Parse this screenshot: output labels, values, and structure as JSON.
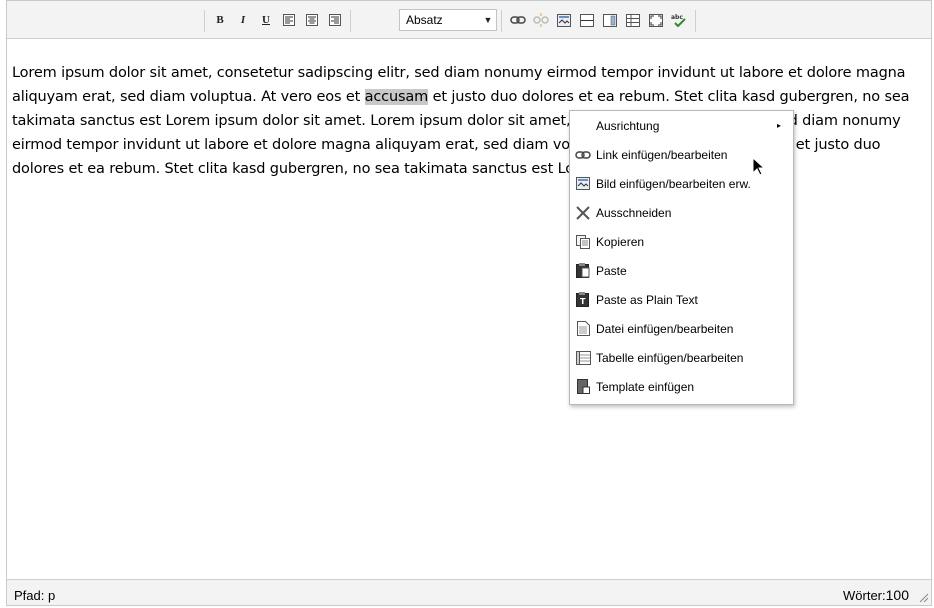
{
  "toolbar": {
    "format_select": {
      "value": "Absatz"
    },
    "buttons": [
      "bold",
      "italic",
      "underline",
      "align-left",
      "align-center",
      "align-right",
      "link",
      "unlink",
      "image",
      "horizontal-rule",
      "template",
      "table",
      "fullscreen",
      "spellcheck"
    ],
    "bold_label": "B",
    "italic_label": "I",
    "underline_label": "U"
  },
  "editor": {
    "text_before": "Lorem ipsum dolor sit amet, consetetur sadipscing elitr, sed diam nonumy eirmod tempor invidunt ut labore et dolore magna aliquyam erat, sed diam voluptua. At vero eos et ",
    "selected_word": "accusam",
    "text_after": " et justo duo dolores et ea rebum. Stet clita kasd gubergren, no sea takimata sanctus est Lorem ipsum dolor sit amet. Lorem ipsum dolor sit amet, consetetur sadipscing elitr, sed diam nonumy eirmod tempor invidunt ut labore et dolore magna aliquyam erat, sed diam voluptua. At vero eos et accusam et justo duo dolores et ea rebum. Stet clita kasd gubergren, no sea takimata sanctus est Lorem ipsum dolor sit amet."
  },
  "context_menu": {
    "items": [
      {
        "label": "Ausrichtung",
        "icon": "none",
        "submenu": "▸"
      },
      {
        "label": "Link einfügen/bearbeiten",
        "icon": "link-icon"
      },
      {
        "label": "Bild einfügen/bearbeiten erw.",
        "icon": "image-icon"
      },
      {
        "label": "Ausschneiden",
        "icon": "scissors-icon"
      },
      {
        "label": "Kopieren",
        "icon": "copy-icon"
      },
      {
        "label": "Paste",
        "icon": "paste-icon"
      },
      {
        "label": "Paste as Plain Text",
        "icon": "paste-text-icon"
      },
      {
        "label": "Datei einfügen/bearbeiten",
        "icon": "file-icon"
      },
      {
        "label": "Tabelle einfügen/bearbeiten",
        "icon": "table-icon"
      },
      {
        "label": "Template einfügen",
        "icon": "template-icon"
      }
    ]
  },
  "statusbar": {
    "path": "Pfad: p",
    "words_label": "Wörter:",
    "words_count": "100"
  }
}
